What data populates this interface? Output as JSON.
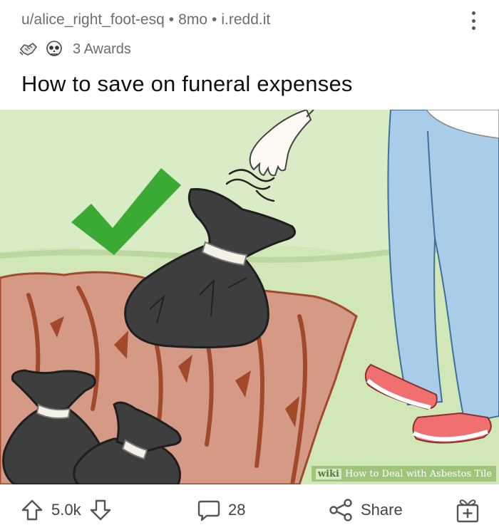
{
  "header": {
    "author": "u/alice_right_foot-esq",
    "age": "8mo",
    "domain": "i.redd.it",
    "separator": "•"
  },
  "awards": {
    "label": "3 Awards",
    "icons": [
      "handshake-award-icon",
      "skull-award-icon"
    ]
  },
  "post": {
    "title": "How to save on funeral expenses"
  },
  "image": {
    "watermark_brand": "wiki",
    "watermark_text": "How to Deal with Asbestos Tile"
  },
  "actions": {
    "upvote_count": "5.0k",
    "comment_count": "28",
    "share_label": "Share"
  },
  "colors": {
    "meta_text": "#6b6e72",
    "title_text": "#111111",
    "check_green": "#3aaa35",
    "bag_dark": "#3e3e3e",
    "jeans_blue": "#a9cce9"
  }
}
